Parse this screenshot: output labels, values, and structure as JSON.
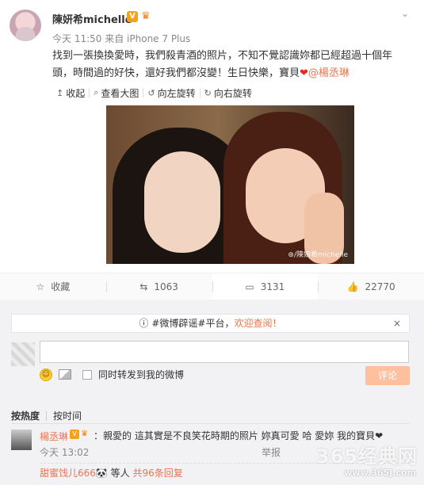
{
  "post": {
    "username": "陳妍希michelle",
    "v_badge": "V",
    "crown": "♛",
    "time": "今天 11:50",
    "via": "来自 iPhone 7 Plus",
    "content_line1": "找到一張換換愛時，我們殺青酒的照片，不知不覺認識妳都已經超過十個年",
    "content_line2_a": "頭，時間過的好快，還好我們都沒變！生日快樂，寶貝",
    "heart": "❤",
    "mention": "@楊丞琳",
    "chevron": "⌄"
  },
  "image_toolbar": {
    "collapse": "收起",
    "view_large": "查看大图",
    "rotate_left": "向左旋转",
    "rotate_right": "向右旋转"
  },
  "photo": {
    "watermark": "⊛/陳妍希michelle"
  },
  "actions": {
    "favorite": "收藏",
    "repost": "1063",
    "comment": "3131",
    "like": "22770"
  },
  "notice": {
    "prefix": "#微博辟谣#平台，",
    "highlight": "欢迎查阅！",
    "close": "×"
  },
  "composer": {
    "sync_label": "同时转发到我的微博",
    "submit": "评论"
  },
  "sort": {
    "hot": "按热度",
    "time": "按时间"
  },
  "comment": {
    "name": "楊丞琳",
    "text": "：親愛的 這其實是不良笑花時期的照片 妳真可愛 哈 愛妳 我的寶貝❤",
    "time": "今天 13:02",
    "actions": "举报",
    "reply_user": "甜蜜饯儿666",
    "reply_mid": "🐼 等人 ",
    "reply_count": "共96条回复"
  },
  "site_watermark": {
    "big": "365经典网",
    "url": "www.365J.com"
  }
}
